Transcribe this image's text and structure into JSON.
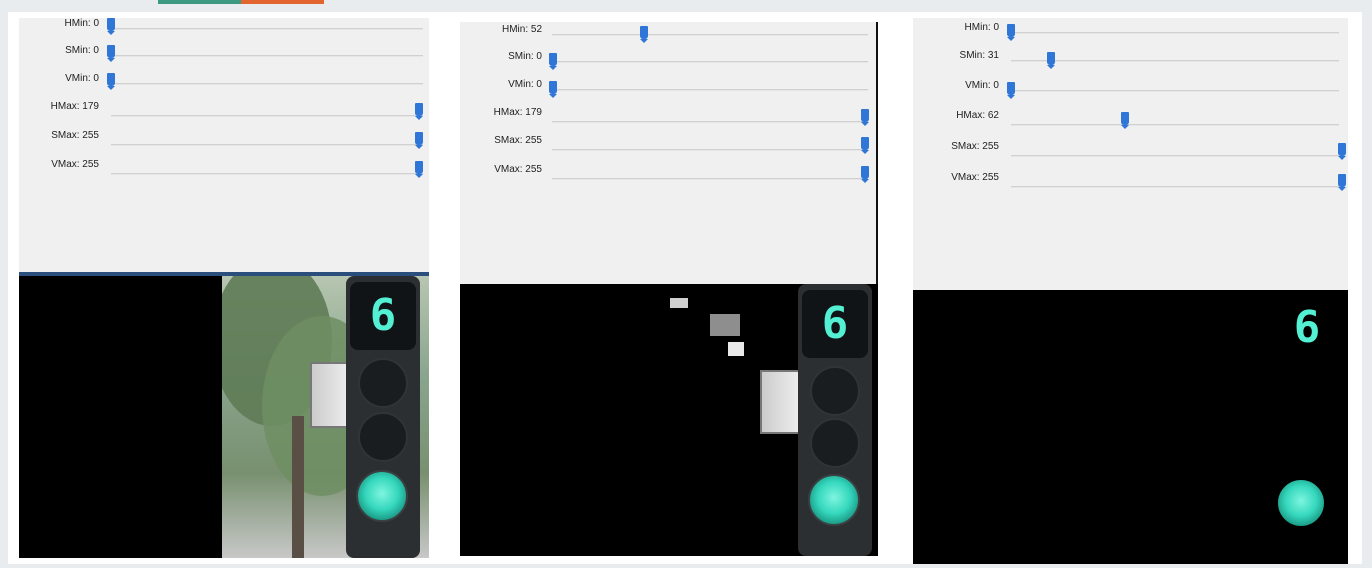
{
  "colors": {
    "background": "#e9ecee",
    "slider_handle": "#2f76d6",
    "accent_green": "#3d9a82",
    "accent_orange": "#e2642f",
    "countdown_digit": "#54f0d4"
  },
  "countdown_digit": "6",
  "panels": [
    {
      "sliders": [
        {
          "label": "HMin: 0",
          "value": 0,
          "max": 179
        },
        {
          "label": "SMin: 0",
          "value": 0,
          "max": 255
        },
        {
          "label": "VMin: 0",
          "value": 0,
          "max": 255
        },
        {
          "label": "HMax: 179",
          "value": 179,
          "max": 179
        },
        {
          "label": "SMax: 255",
          "value": 255,
          "max": 255
        },
        {
          "label": "VMax: 255",
          "value": 255,
          "max": 255
        }
      ],
      "mask_view": "black",
      "result_view": "full color"
    },
    {
      "sliders": [
        {
          "label": "HMin: 52",
          "value": 52,
          "max": 179
        },
        {
          "label": "SMin: 0",
          "value": 0,
          "max": 255
        },
        {
          "label": "VMin: 0",
          "value": 0,
          "max": 255
        },
        {
          "label": "HMax: 179",
          "value": 179,
          "max": 179
        },
        {
          "label": "SMax: 255",
          "value": 255,
          "max": 255
        },
        {
          "label": "VMax: 255",
          "value": 255,
          "max": 255
        }
      ],
      "mask_view": "black",
      "result_view": "partial mask"
    },
    {
      "sliders": [
        {
          "label": "HMin: 0",
          "value": 0,
          "max": 179
        },
        {
          "label": "SMin: 31",
          "value": 31,
          "max": 255
        },
        {
          "label": "VMin: 0",
          "value": 0,
          "max": 255
        },
        {
          "label": "HMax: 62",
          "value": 62,
          "max": 179
        },
        {
          "label": "SMax: 255",
          "value": 255,
          "max": 255
        },
        {
          "label": "VMax: 255",
          "value": 255,
          "max": 255
        }
      ],
      "mask_view": "black",
      "result_view": "green only"
    }
  ]
}
